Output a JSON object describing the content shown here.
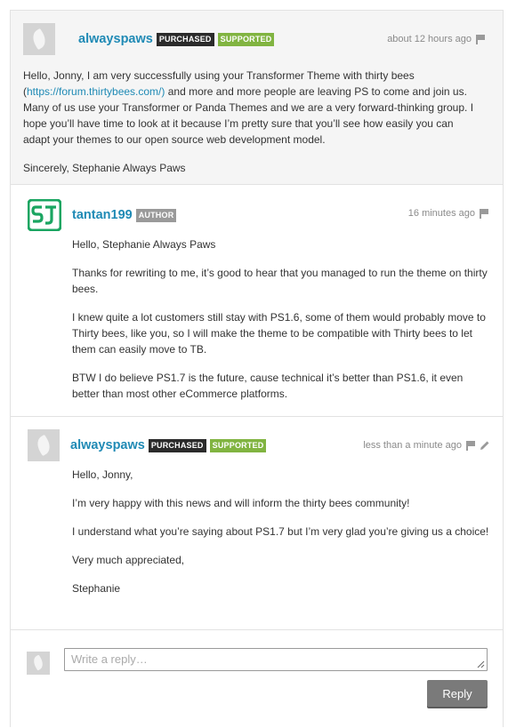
{
  "comments": [
    {
      "username": "alwayspaws",
      "badges": [
        "PURCHASED",
        "SUPPORTED"
      ],
      "time": "about 12 hours ago",
      "paragraphs": [
        {
          "pre": "Hello, Jonny, I am very successfully using your Transformer Theme with thirty bees (",
          "link": "https://forum.thirtybees.com/)",
          "post": " and more and more people are leaving PS to come and join us. Many of us use your Transformer or Panda Themes and we are a very forward-thinking group. I hope you’ll have time to look at it because I’m pretty sure that you’ll see how easily you can adapt your themes to our open source web development model."
        },
        {
          "text": "Sincerely, Stephanie Always Paws"
        }
      ]
    },
    {
      "username": "tantan199",
      "badges": [
        "AUTHOR"
      ],
      "time": "16 minutes ago",
      "paragraphs": [
        "Hello, Stephanie Always Paws",
        "Thanks for rewriting to me, it’s good to hear that you managed to run the theme on thirty bees.",
        "I knew quite a lot customers still stay with PS1.6, some of them would probably move to Thirty bees, like you, so I will make the theme to be compatible with Thirty bees to let them can easily move to TB.",
        "BTW I do believe PS1.7 is the future, cause technical it’s better than PS1.6, it even better than most other eCommerce platforms."
      ]
    },
    {
      "username": "alwayspaws",
      "badges": [
        "PURCHASED",
        "SUPPORTED"
      ],
      "time": "less than a minute ago",
      "paragraphs": [
        "Hello, Jonny,",
        "I’m very happy with this news and will inform the thirty bees community!",
        "I understand what you’re saying about PS1.7 but I’m very glad you’re giving us a choice!",
        "Very much appreciated,",
        "Stephanie"
      ]
    }
  ],
  "reply_box": {
    "placeholder": "Write a reply…",
    "button_label": "Reply"
  },
  "colors": {
    "link": "#1f8ab5",
    "badge_purchased": "#2b2b2b",
    "badge_supported": "#81b441",
    "badge_author": "#9a9a9a",
    "st_logo": "#1aa561",
    "reply_button": "#7a7a7a"
  },
  "icons": [
    "flag-icon",
    "pencil-icon",
    "avatar-leaf-icon",
    "st-logo-icon"
  ]
}
